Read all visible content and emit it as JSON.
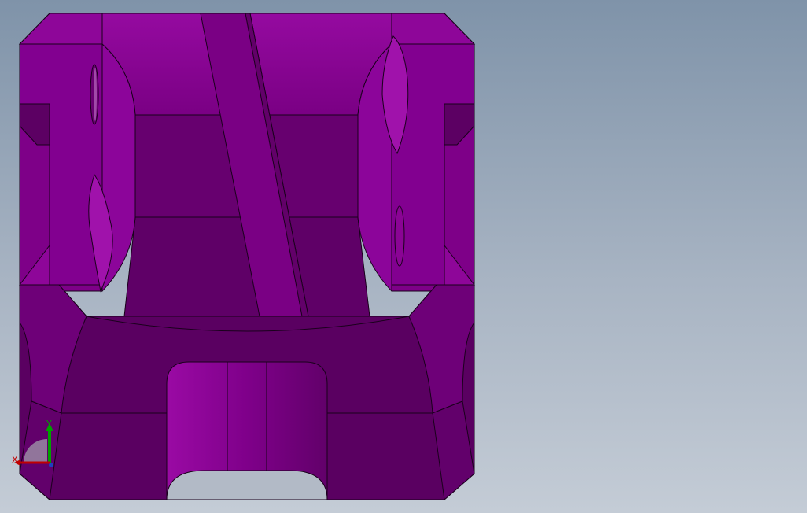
{
  "viewport": {
    "background_top": "#7f93a9",
    "background_bottom": "#c4ccd6"
  },
  "model": {
    "color_light": "#8a0294",
    "color_mid": "#76007f",
    "color_dark": "#5c0063",
    "edge_color": "#1a001c"
  },
  "triad": {
    "x_label": "X",
    "y_label": "Y",
    "x_color": "#c00000",
    "y_color": "#00a000",
    "z_color": "#2040c0"
  }
}
